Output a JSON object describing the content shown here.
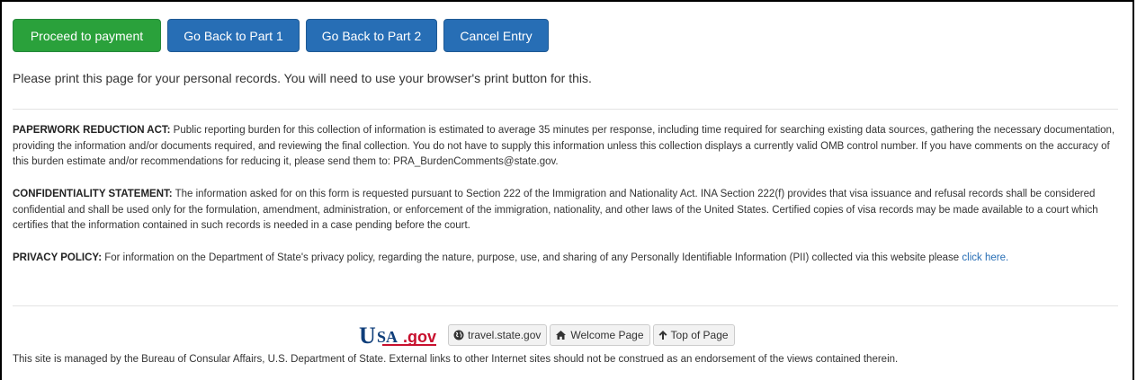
{
  "actions": {
    "proceed": "Proceed to payment",
    "back_part1": "Go Back to Part 1",
    "back_part2": "Go Back to Part 2",
    "cancel": "Cancel Entry"
  },
  "colors": {
    "success": "#2aa13b",
    "primary": "#276eb5",
    "link": "#276eb5"
  },
  "print_note": "Please print this page for your personal records. You will need to use your browser's print button for this.",
  "paperwork": {
    "heading": "PAPERWORK REDUCTION ACT:",
    "body": " Public reporting burden for this collection of information is estimated to average 35 minutes per response, including time required for searching existing data sources, gathering the necessary documentation, providing the information and/or documents required, and reviewing the final collection. You do not have to supply this information unless this collection displays a currently valid OMB control number. If you have comments on the accuracy of this burden estimate and/or recommendations for reducing it, please send them to: PRA_BurdenComments@state.gov."
  },
  "confidentiality": {
    "heading": "CONFIDENTIALITY STATEMENT:",
    "body": " The information asked for on this form is requested pursuant to Section 222 of the Immigration and Nationality Act. INA Section 222(f) provides that visa issuance and refusal records shall be considered confidential and shall be used only for the formulation, amendment, administration, or enforcement of the immigration, nationality, and other laws of the United States. Certified copies of visa records may be made available to a court which certifies that the information contained in such records is needed in a case pending before the court."
  },
  "privacy": {
    "heading": "PRIVACY POLICY:",
    "body": " For information on the Department of State's privacy policy, regarding the nature, purpose, use, and sharing of any Personally Identifiable Information (PII) collected via this website please ",
    "link": "click here."
  },
  "footer": {
    "logo": {
      "u": "U",
      "sa": "SA",
      "gov": ".gov"
    },
    "links": [
      {
        "label": "travel.state.gov",
        "icon": "globe-icon"
      },
      {
        "label": "Welcome Page",
        "icon": "home-icon"
      },
      {
        "label": "Top of Page",
        "icon": "arrow-up-icon"
      }
    ],
    "managed_text": "This site is managed by the Bureau of Consular Affairs, U.S. Department of State. External links to other Internet sites should not be construed as an endorsement of the views contained therein."
  }
}
